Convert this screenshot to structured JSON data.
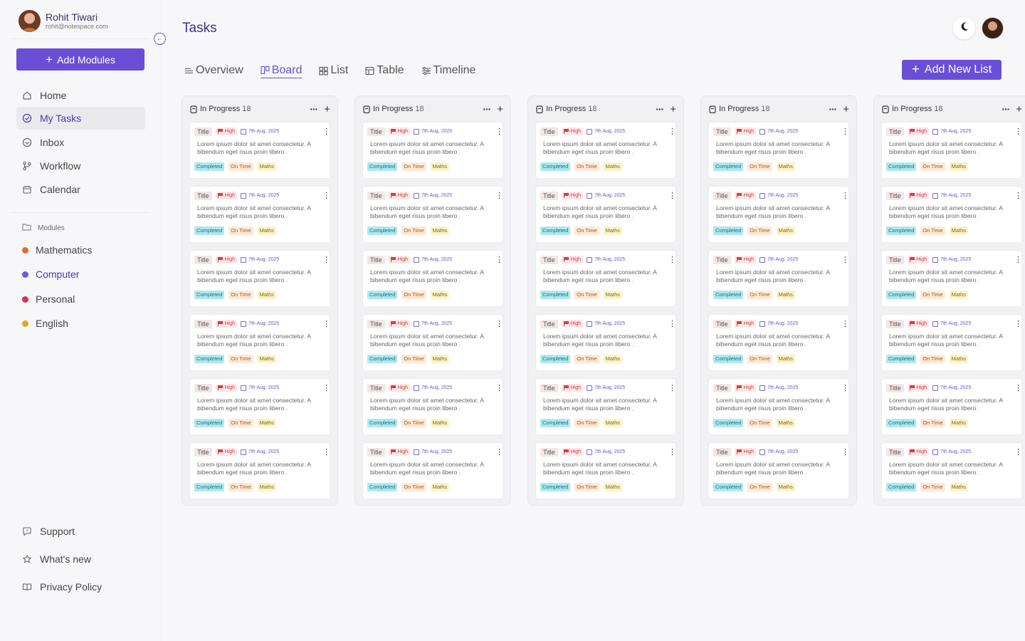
{
  "user": {
    "name": "Rohit Tiwari",
    "email": "rohit@notespace.com"
  },
  "sidebar": {
    "add_modules_label": "Add Modules",
    "nav": [
      {
        "label": "Home",
        "icon": "home-icon"
      },
      {
        "label": "My Tasks",
        "icon": "check-circle-icon",
        "active": true
      },
      {
        "label": "Inbox",
        "icon": "inbox-icon"
      },
      {
        "label": "Workflow",
        "icon": "workflow-icon"
      },
      {
        "label": "Calendar",
        "icon": "calendar-icon"
      }
    ],
    "modules_label": "Modules",
    "modules": [
      {
        "label": "Mathematics",
        "color": "#e8673a"
      },
      {
        "label": "Computer",
        "color": "#6b5de0",
        "active": true
      },
      {
        "label": "Personal",
        "color": "#d8334f"
      },
      {
        "label": "English",
        "color": "#d4ad1f"
      }
    ],
    "footer": [
      {
        "label": "Support",
        "icon": "support-icon"
      },
      {
        "label": "What's new",
        "icon": "star-icon"
      },
      {
        "label": "Privacy Policy",
        "icon": "book-icon"
      }
    ]
  },
  "header": {
    "title": "Tasks",
    "add_list_label": "Add New List"
  },
  "tabs": [
    {
      "label": "Overview",
      "icon": "overview-icon"
    },
    {
      "label": "Board",
      "icon": "board-icon",
      "active": true
    },
    {
      "label": "List",
      "icon": "list-icon"
    },
    {
      "label": "Table",
      "icon": "table-icon"
    },
    {
      "label": "Timeline",
      "icon": "timeline-icon"
    }
  ],
  "columns": [
    {
      "title": "In Progress",
      "count": "18"
    },
    {
      "title": "In Progress",
      "count": "18"
    },
    {
      "title": "In Progress",
      "count": "18"
    },
    {
      "title": "In Progress",
      "count": "18"
    },
    {
      "title": "In Progress",
      "count": "18"
    }
  ],
  "card": {
    "title": "Title",
    "priority": "High",
    "date": "7th Aug, 2025",
    "text": "Lorem ipsum dolor sit amet consectetur. A bibendum eget risus proin libero .",
    "tags": [
      "Completed",
      "On Time",
      "Maths"
    ]
  },
  "cards_per_column": 6
}
